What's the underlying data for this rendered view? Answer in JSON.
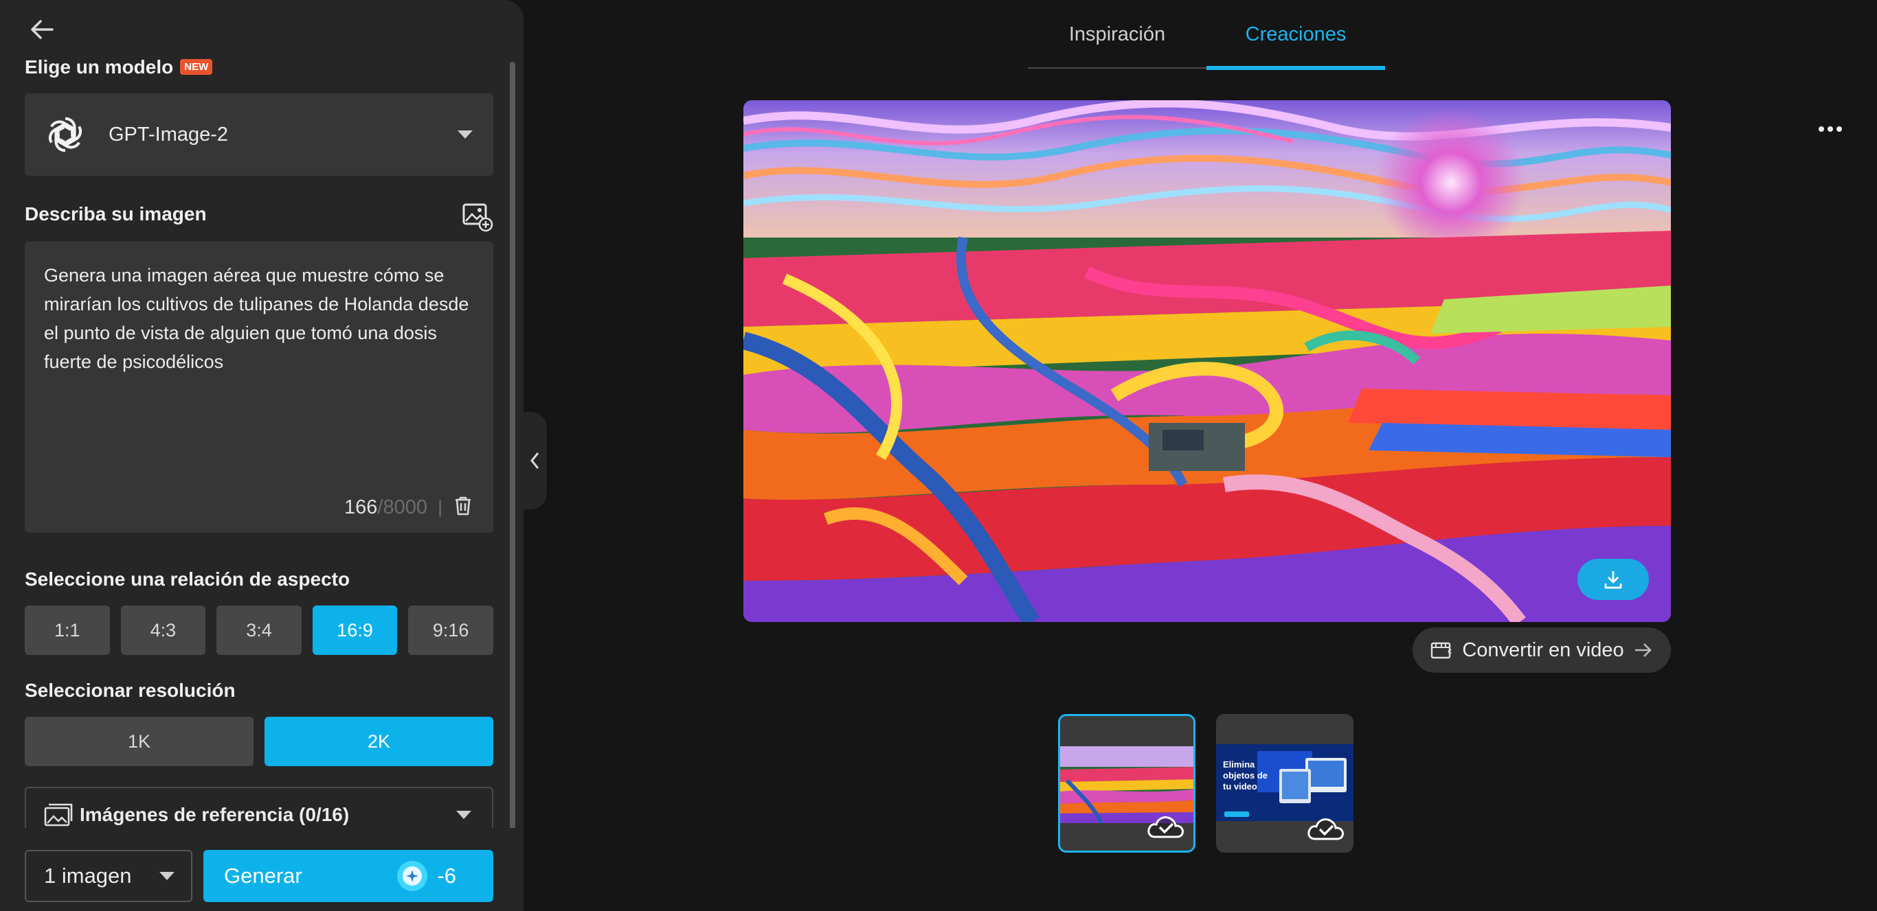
{
  "sidebar": {
    "model_section_title": "Elige un modelo",
    "new_badge": "NEW",
    "model_name": "GPT-Image-2",
    "describe_title": "Describa su imagen",
    "prompt_text": "Genera una imagen aérea que muestre cómo se mirarían los cultivos de tulipanes de Holanda desde el punto de vista de alguien que tomó una dosis fuerte de psicodélicos",
    "char_count": "166",
    "char_max": "/8000",
    "separator": "|",
    "aspect_title": "Seleccione una relación de aspecto",
    "aspect_ratios": [
      "1:1",
      "4:3",
      "3:4",
      "16:9",
      "9:16"
    ],
    "aspect_selected": "16:9",
    "resolution_title": "Seleccionar resolución",
    "resolutions": [
      "1K",
      "2K"
    ],
    "resolution_selected": "2K",
    "reference_label": "Imágenes de referencia (0/16)",
    "image_count": "1 imagen",
    "generate_label": "Generar",
    "credit_cost": "-6"
  },
  "tabs": [
    "Inspiración",
    "Creaciones"
  ],
  "active_tab": "Creaciones",
  "convert_label": "Convertir en video",
  "thumbnails": [
    {
      "name": "tulip-fields",
      "selected": true
    },
    {
      "name": "promo",
      "selected": false,
      "text": "Elimina objetos de tu video"
    }
  ],
  "icons": [
    "back-arrow-icon",
    "openai-logo-icon",
    "add-image-icon",
    "trash-icon",
    "image-icon",
    "credit-star-icon",
    "more-dots-icon",
    "download-icon",
    "video-icon",
    "arrow-right-icon",
    "cloud-check-icon",
    "chevron-left-icon"
  ],
  "colors": {
    "accent": "#0eb2ea",
    "panel": "#262626",
    "background": "#151515",
    "badge": "#e8542d"
  }
}
